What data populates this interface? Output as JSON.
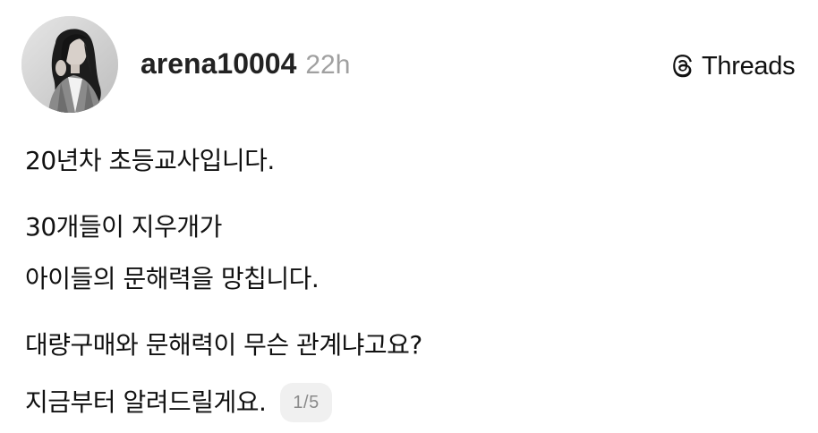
{
  "post": {
    "author": {
      "username": "arena10004",
      "avatar": "profile-photo"
    },
    "timestamp": "22h",
    "brand": {
      "label": "Threads",
      "icon": "threads-logo-icon"
    },
    "lines": [
      "20년차 초등교사입니다.",
      "30개들이 지우개가",
      "아이들의 문해력을 망칩니다.",
      "대량구매와 문해력이 무슨 관계냐고요?",
      "지금부터 알려드릴게요."
    ],
    "pagination": "1/5"
  },
  "colors": {
    "background": "#ffffff",
    "text": "#111111",
    "timestamp": "#a0a0a0",
    "badge_bg": "#f0f0f0",
    "badge_text": "#8a8a8a"
  }
}
